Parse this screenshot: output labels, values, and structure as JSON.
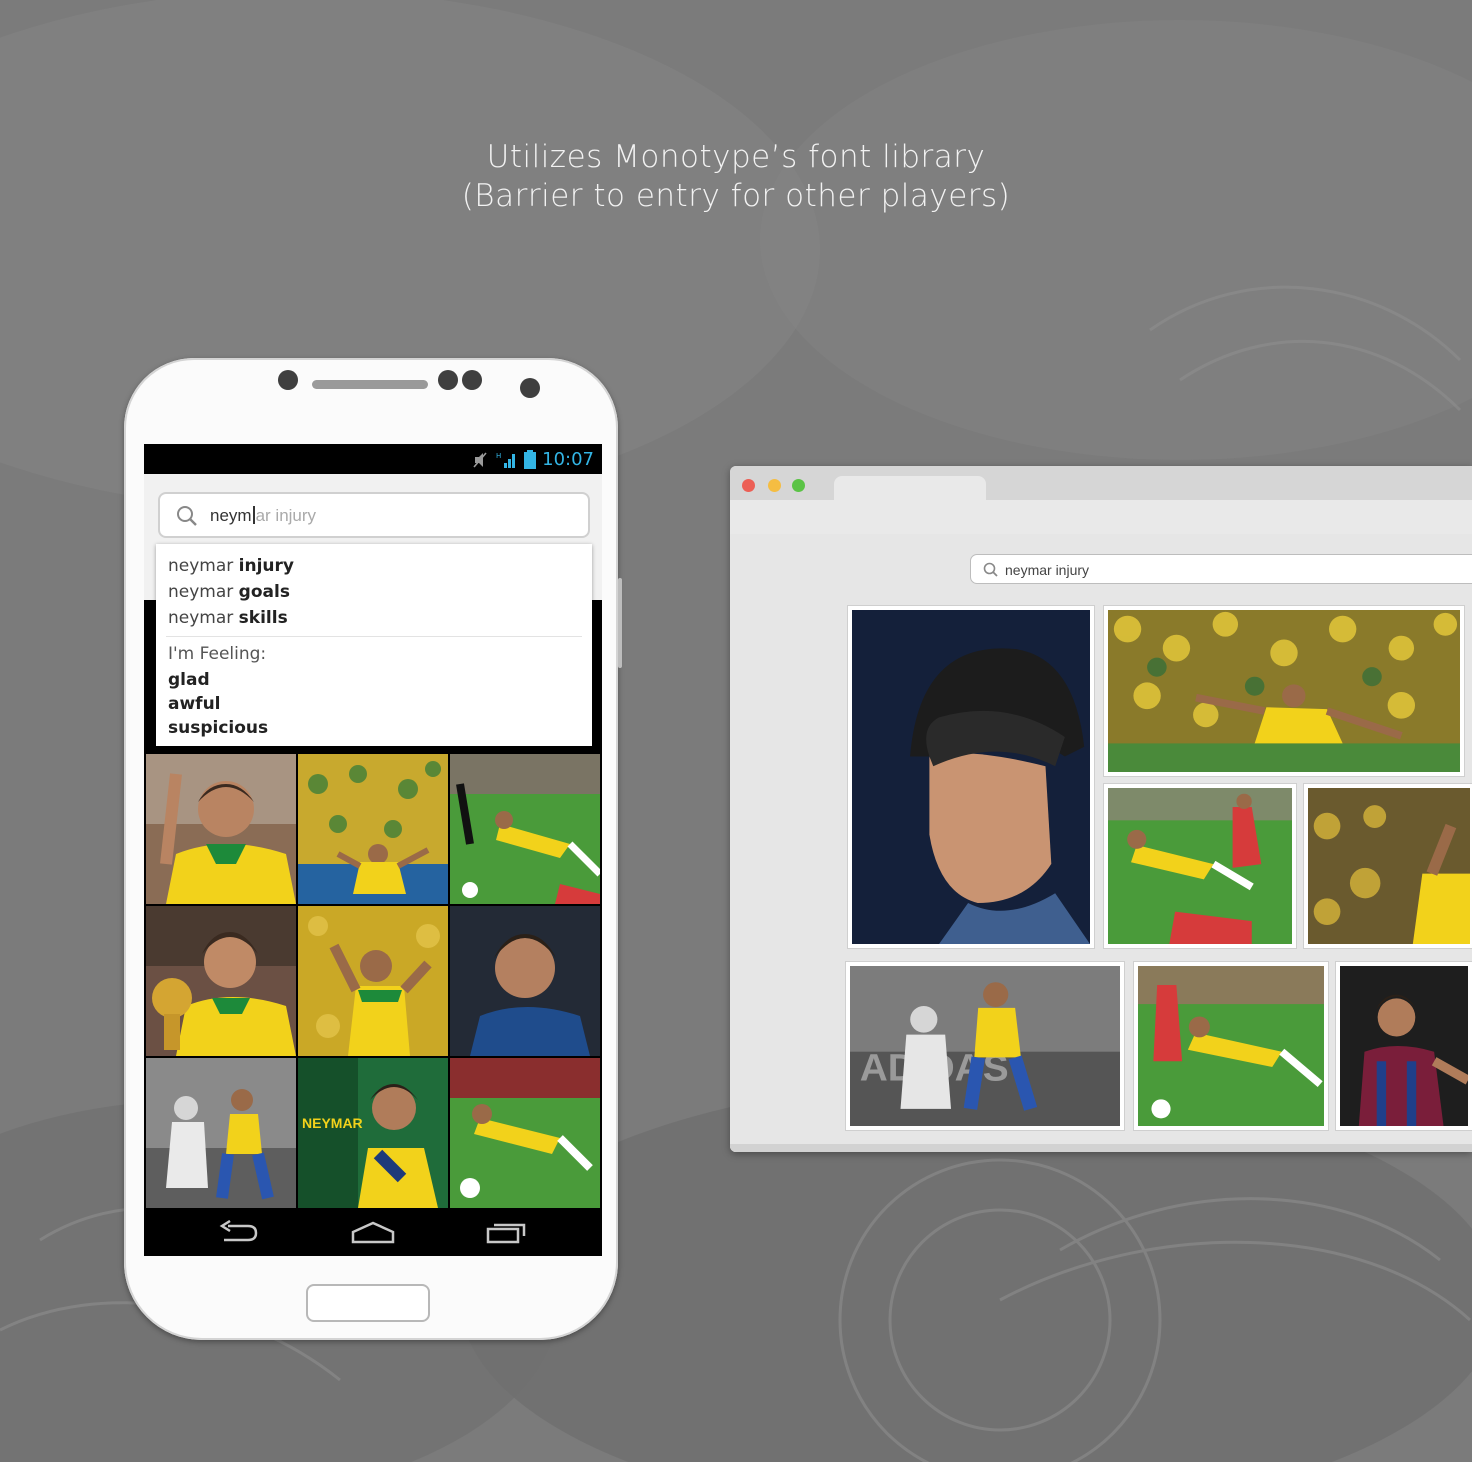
{
  "headline": {
    "line1": "Utilizes Monotype’s font library",
    "line2": "(Barrier to entry for other players)"
  },
  "phone": {
    "status_time": "10:07",
    "status_icons": [
      "mute-icon",
      "hsdpa-signal-icon",
      "battery-icon"
    ],
    "search": {
      "typed": "neym",
      "autocomplete_rest": "ar injury"
    },
    "suggestions": [
      {
        "prefix": "neymar ",
        "bold": "injury"
      },
      {
        "prefix": "neymar ",
        "bold": "goals"
      },
      {
        "prefix": "neymar ",
        "bold": "skills"
      }
    ],
    "feeling_label": "I'm Feeling:",
    "moods": [
      "glad",
      "awful",
      "suspicious"
    ],
    "nav_icons": [
      "back-icon",
      "home-icon",
      "recent-apps-icon"
    ]
  },
  "browser": {
    "search_value": "neymar injury",
    "window_controls": [
      "close",
      "minimize",
      "zoom"
    ],
    "colors": {
      "close": "#ec5f55",
      "minimize": "#f5bd42",
      "zoom": "#5bc346"
    }
  },
  "colors": {
    "android_status_blue": "#33b5e5",
    "kit_yellow": "#f2d21b",
    "kit_green": "#1d8a3a",
    "pitch_green": "#4a9b3a"
  }
}
